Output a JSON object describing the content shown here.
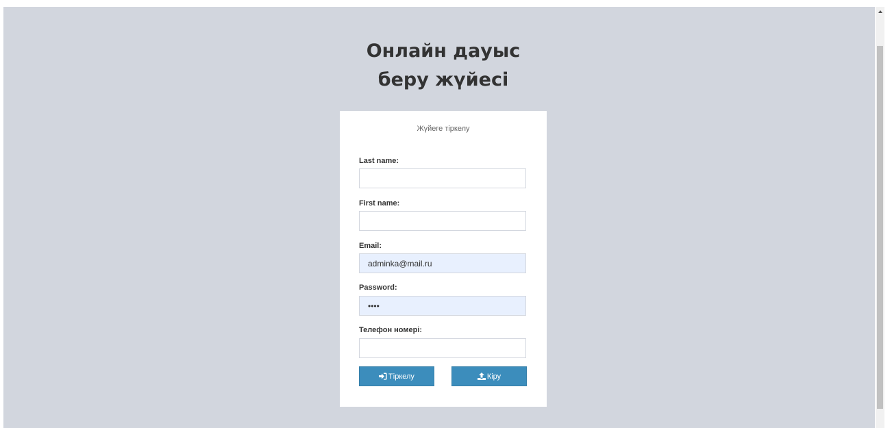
{
  "page": {
    "title": "Онлайн дауыс беру жүйесі"
  },
  "form": {
    "subtitle": "Жүйеге тіркелу",
    "fields": [
      {
        "label": "Last name:",
        "value": "",
        "type": "text"
      },
      {
        "label": "First name:",
        "value": "",
        "type": "text"
      },
      {
        "label": "Email:",
        "value": "adminka@mail.ru",
        "type": "email"
      },
      {
        "label": "Password:",
        "value": "1234",
        "type": "password"
      },
      {
        "label": "Телефон номері:",
        "value": "",
        "type": "tel"
      }
    ],
    "buttons": {
      "register": {
        "label": "Тіркелу",
        "icon": "sign-in-icon"
      },
      "login": {
        "label": "Кіру",
        "icon": "upload-icon"
      }
    }
  },
  "colors": {
    "background": "#d2d6de",
    "card": "#ffffff",
    "button": "#3c8dbc",
    "autofill": "#e8f0fe"
  }
}
